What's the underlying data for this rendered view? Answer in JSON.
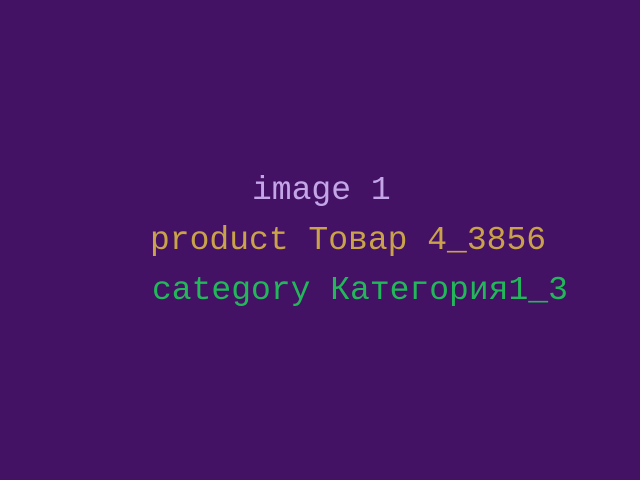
{
  "image_label": "image 1",
  "product_line": "product Товар 4_3856",
  "category_line": "category Категория1_3",
  "colors": {
    "background": "#441264",
    "image_label": "#c4a6e8",
    "product": "#c9a24a",
    "category": "#22b85a"
  }
}
